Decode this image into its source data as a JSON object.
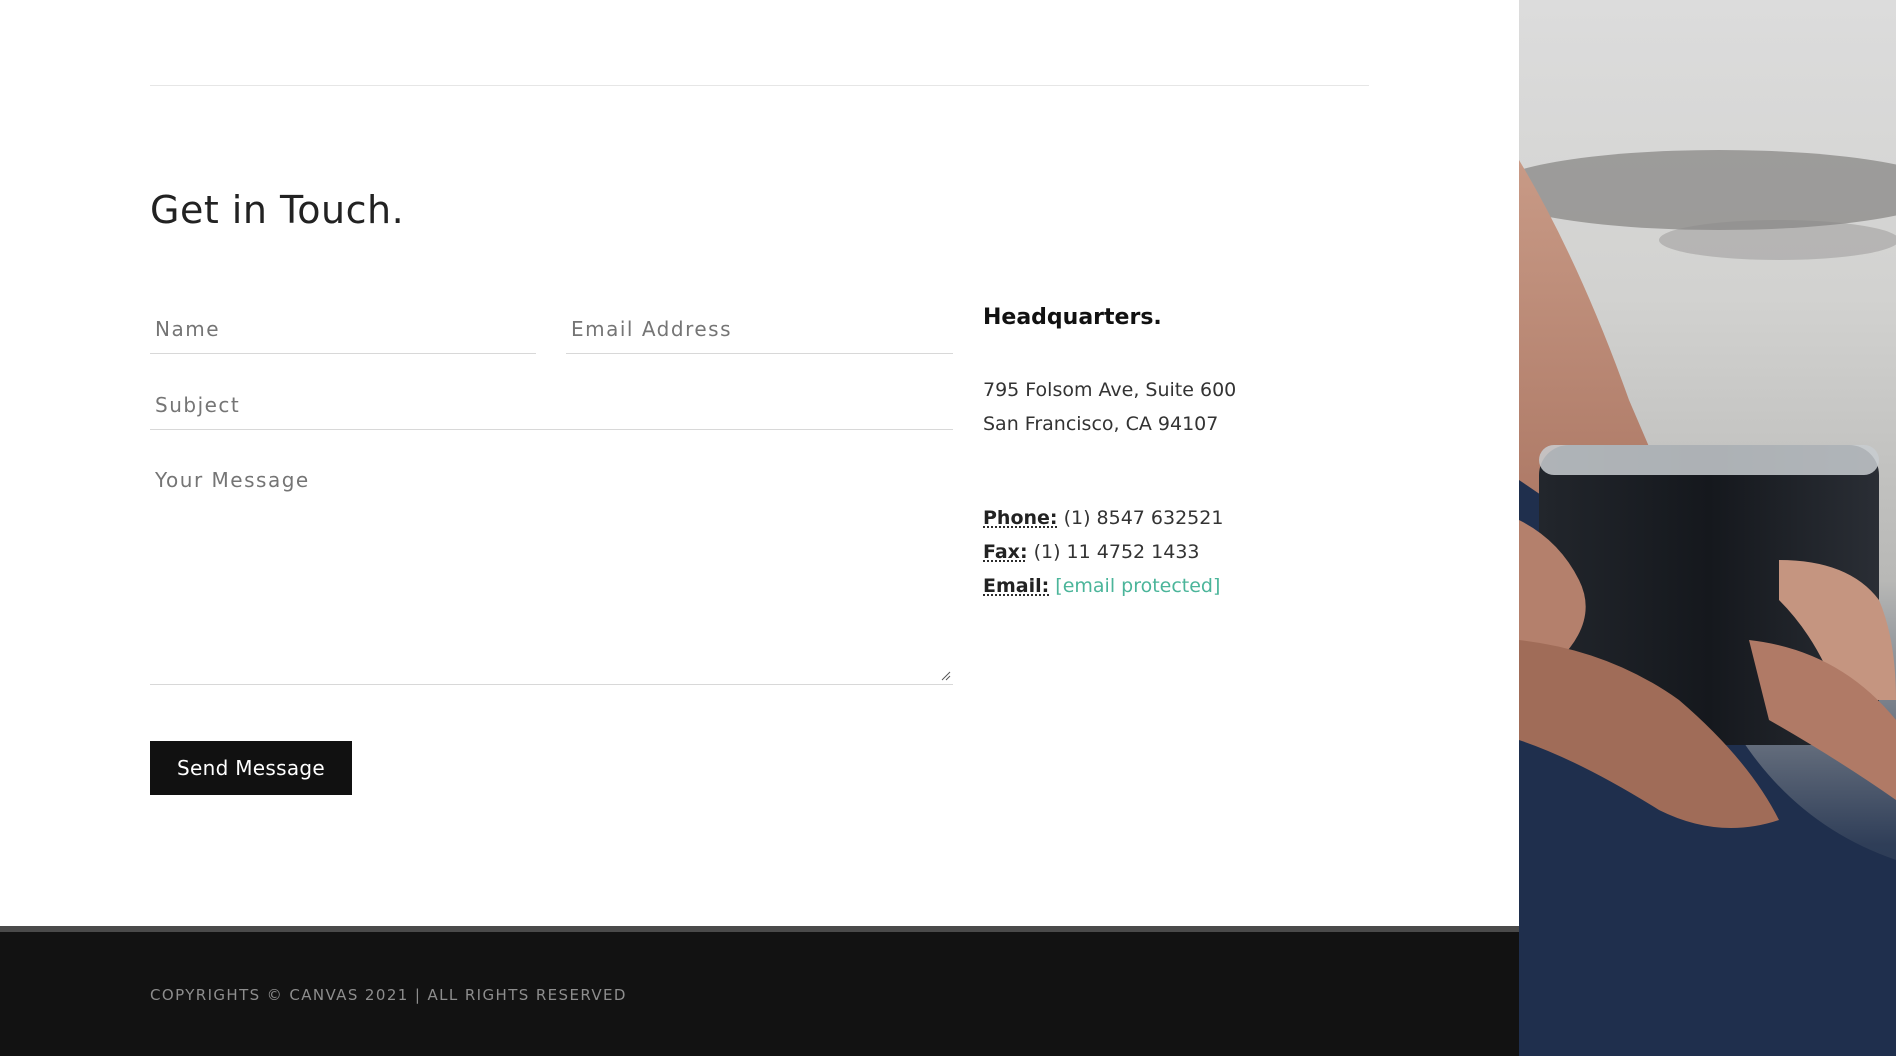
{
  "contact": {
    "title": "Get in Touch.",
    "form": {
      "name_placeholder": "Name",
      "email_placeholder": "Email Address",
      "subject_placeholder": "Subject",
      "message_placeholder": "Your Message",
      "submit_label": "Send Message"
    },
    "headquarters": {
      "title": "Headquarters.",
      "address_line1": "795 Folsom Ave, Suite 600",
      "address_line2": "San Francisco, CA 94107",
      "phone_label": "Phone:",
      "phone_value": "(1) 8547 632521",
      "fax_label": "Fax:",
      "fax_value": "(1) 11 4752 1433",
      "email_label": "Email:",
      "email_value": "[email protected]"
    }
  },
  "footer": {
    "copyright": "COPYRIGHTS © CANVAS 2021 | ALL RIGHTS RESERVED"
  },
  "colors": {
    "accent": "#4bb59a",
    "button_bg": "#111111",
    "footer_bg": "#121212",
    "footer_rule": "#4a4a4a"
  },
  "icons": {
    "textarea_resize": "resize-grip-icon",
    "side_image": "hand-holding-phone-photo"
  }
}
